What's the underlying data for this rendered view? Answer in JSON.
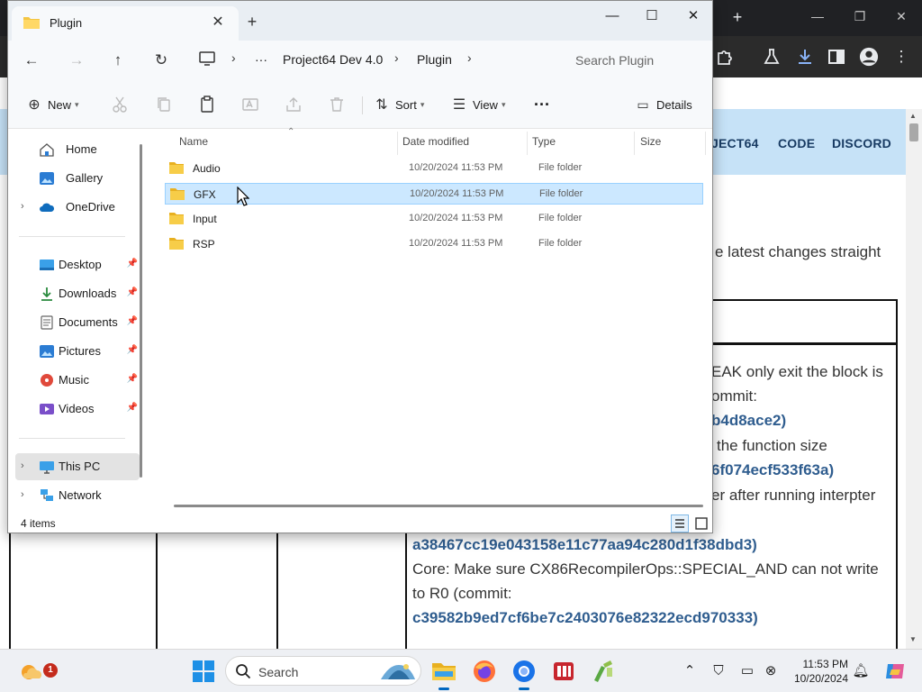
{
  "browser": {
    "nav_links": [
      "JECT64",
      "CODE",
      "DISCORD"
    ],
    "intro_fragment": "e latest changes straight",
    "changelog_lines": [
      {
        "text": "EAK only exit the block is",
        "kind": "text"
      },
      {
        "text": "ommit:",
        "kind": "text"
      },
      {
        "text": "b4d8ace2)",
        "kind": "link"
      },
      {
        "text": "the function size",
        "kind": "text"
      },
      {
        "text": "6f074ecf533f63a)",
        "kind": "link"
      },
      {
        "text": "er after running interpter",
        "kind": "text"
      }
    ],
    "changelog_full": [
      {
        "text": "a38467cc19e043158e11c77aa94c280d1f38dbd3)",
        "kind": "link"
      },
      {
        "text": "Core: Make sure CX86RecompilerOps::SPECIAL_AND can not write",
        "kind": "text"
      },
      {
        "text": "to R0 (commit:",
        "kind": "text"
      },
      {
        "text": "c39582b9ed7cf6be7c2403076e82322ecd970333)",
        "kind": "link"
      }
    ]
  },
  "explorer": {
    "tab_title": "Plugin",
    "breadcrumb": [
      "Project64 Dev 4.0",
      "Plugin"
    ],
    "search_placeholder": "Search Plugin",
    "cmdbar": {
      "new_label": "New",
      "sort_label": "Sort",
      "view_label": "View",
      "more_label": "···",
      "details_label": "Details"
    },
    "nav_pane": [
      {
        "label": "Home",
        "icon": "home-icon",
        "group": 1
      },
      {
        "label": "Gallery",
        "icon": "gallery-icon",
        "group": 1
      },
      {
        "label": "OneDrive",
        "icon": "onedrive-icon",
        "group": 1,
        "expandable": true
      },
      {
        "label": "Desktop",
        "icon": "desktop-icon",
        "group": 2,
        "pinned": true
      },
      {
        "label": "Downloads",
        "icon": "downloads-icon",
        "group": 2,
        "pinned": true
      },
      {
        "label": "Documents",
        "icon": "documents-icon",
        "group": 2,
        "pinned": true
      },
      {
        "label": "Pictures",
        "icon": "pictures-icon",
        "group": 2,
        "pinned": true
      },
      {
        "label": "Music",
        "icon": "music-icon",
        "group": 2,
        "pinned": true
      },
      {
        "label": "Videos",
        "icon": "videos-icon",
        "group": 2,
        "pinned": true
      },
      {
        "label": "This PC",
        "icon": "this-pc-icon",
        "group": 3,
        "expandable": true,
        "selected": true
      },
      {
        "label": "Network",
        "icon": "network-icon",
        "group": 3,
        "expandable": true
      }
    ],
    "columns": [
      "Name",
      "Date modified",
      "Type",
      "Size"
    ],
    "files": [
      {
        "name": "Audio",
        "date": "10/20/2024 11:53 PM",
        "type": "File folder",
        "selected": false
      },
      {
        "name": "GFX",
        "date": "10/20/2024 11:53 PM",
        "type": "File folder",
        "selected": true
      },
      {
        "name": "Input",
        "date": "10/20/2024 11:53 PM",
        "type": "File folder",
        "selected": false
      },
      {
        "name": "RSP",
        "date": "10/20/2024 11:53 PM",
        "type": "File folder",
        "selected": false
      }
    ],
    "status": "4 items"
  },
  "taskbar": {
    "search_label": "Search",
    "weather_badge": "1",
    "time": "11:53 PM",
    "date": "10/20/2024"
  },
  "colors": {
    "folder": "#f4c542",
    "selection": "#cce8ff",
    "link": "#2f5d8f",
    "site_nav_bg": "#c6e2f7",
    "accent": "#0067c0"
  }
}
